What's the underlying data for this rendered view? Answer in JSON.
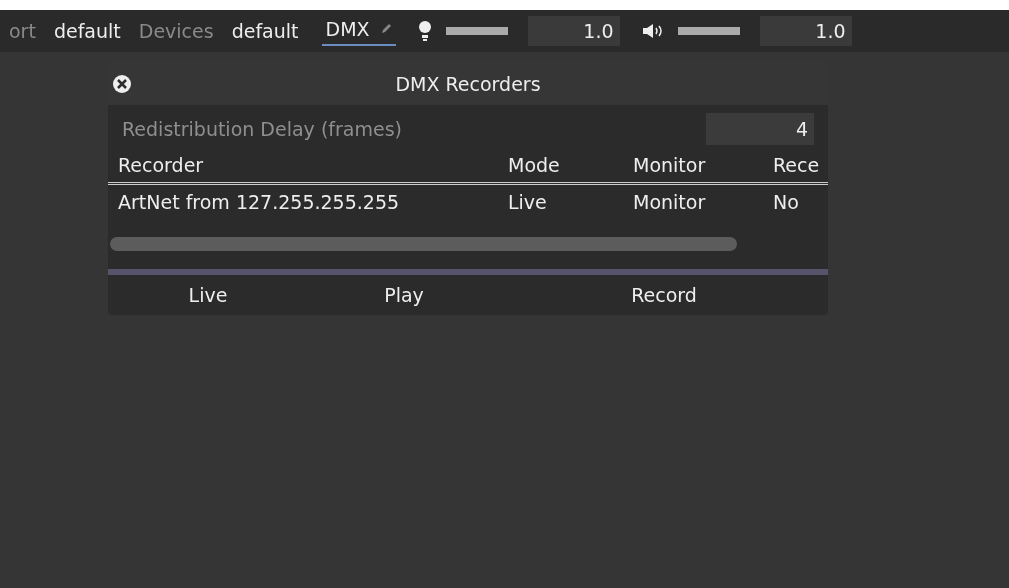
{
  "topbar": {
    "items": [
      {
        "label": "ort",
        "kind": "label"
      },
      {
        "label": "default",
        "kind": "value"
      },
      {
        "label": "Devices",
        "kind": "label"
      },
      {
        "label": "default",
        "kind": "value"
      },
      {
        "label": "DMX",
        "kind": "tab",
        "selected": true
      }
    ],
    "controls": [
      {
        "kind": "light",
        "level": 1,
        "value": "1.0"
      },
      {
        "kind": "sound",
        "level": 1,
        "value": "1.0"
      }
    ]
  },
  "dialog": {
    "title": "DMX Recorders",
    "delay": {
      "label": "Redistribution Delay (frames)",
      "value": "4"
    },
    "columns": [
      "Recorder",
      "Mode",
      "Monitor",
      "Rece"
    ],
    "rows": [
      [
        "ArtNet from 127.255.255.255",
        "Live",
        "Monitor",
        "No"
      ]
    ],
    "buttons": [
      "Live",
      "Play",
      "Record"
    ]
  }
}
